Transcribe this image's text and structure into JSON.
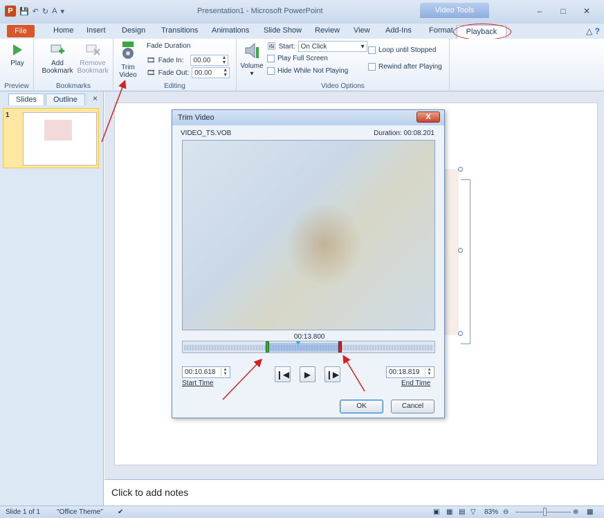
{
  "window": {
    "title": "Presentation1  -  Microsoft PowerPoint",
    "context_tab_group": "Video Tools"
  },
  "tabs": [
    "File",
    "Home",
    "Insert",
    "Design",
    "Transitions",
    "Animations",
    "Slide Show",
    "Review",
    "View",
    "Add-Ins",
    "Format",
    "Playback"
  ],
  "ribbon": {
    "preview": {
      "play_label": "Play",
      "group": "Preview"
    },
    "bookmarks": {
      "add_label_1": "Add",
      "add_label_2": "Bookmark",
      "remove_label_1": "Remove",
      "remove_label_2": "Bookmark",
      "group": "Bookmarks"
    },
    "editing": {
      "trim_label_1": "Trim",
      "trim_label_2": "Video",
      "fade_duration": "Fade Duration",
      "fade_in_label": "Fade In:",
      "fade_in_value": "00.00",
      "fade_out_label": "Fade Out:",
      "fade_out_value": "00.00",
      "group": "Editing"
    },
    "video_options": {
      "volume_label": "Volume",
      "start_label": "Start:",
      "start_value": "On Click",
      "play_full_screen": "Play Full Screen",
      "hide_while_not_playing": "Hide While Not Playing",
      "loop_until_stopped": "Loop until Stopped",
      "rewind_after_playing": "Rewind after Playing",
      "group": "Video Options"
    }
  },
  "left_pane": {
    "tab_slides": "Slides",
    "tab_outline": "Outline",
    "close": "×",
    "slide_number": "1"
  },
  "dialog": {
    "title": "Trim Video",
    "close": "X",
    "file_name": "VIDEO_TS.VOB",
    "duration": "Duration:  00:08.201",
    "playhead_time": "00:13.800",
    "start_time_value": "00:10.618",
    "start_time_label": "Start Time",
    "end_time_value": "00:18.819",
    "end_time_label": "End Time",
    "ok": "OK",
    "cancel": "Cancel"
  },
  "notes_placeholder": "Click to add notes",
  "status": {
    "slide": "Slide 1 of 1",
    "theme": "\"Office Theme\"",
    "zoom": "83%"
  },
  "colors": {
    "file_tab": "#d7562a",
    "annotation": "#d62020",
    "ribbon_text": "#1e395b"
  }
}
